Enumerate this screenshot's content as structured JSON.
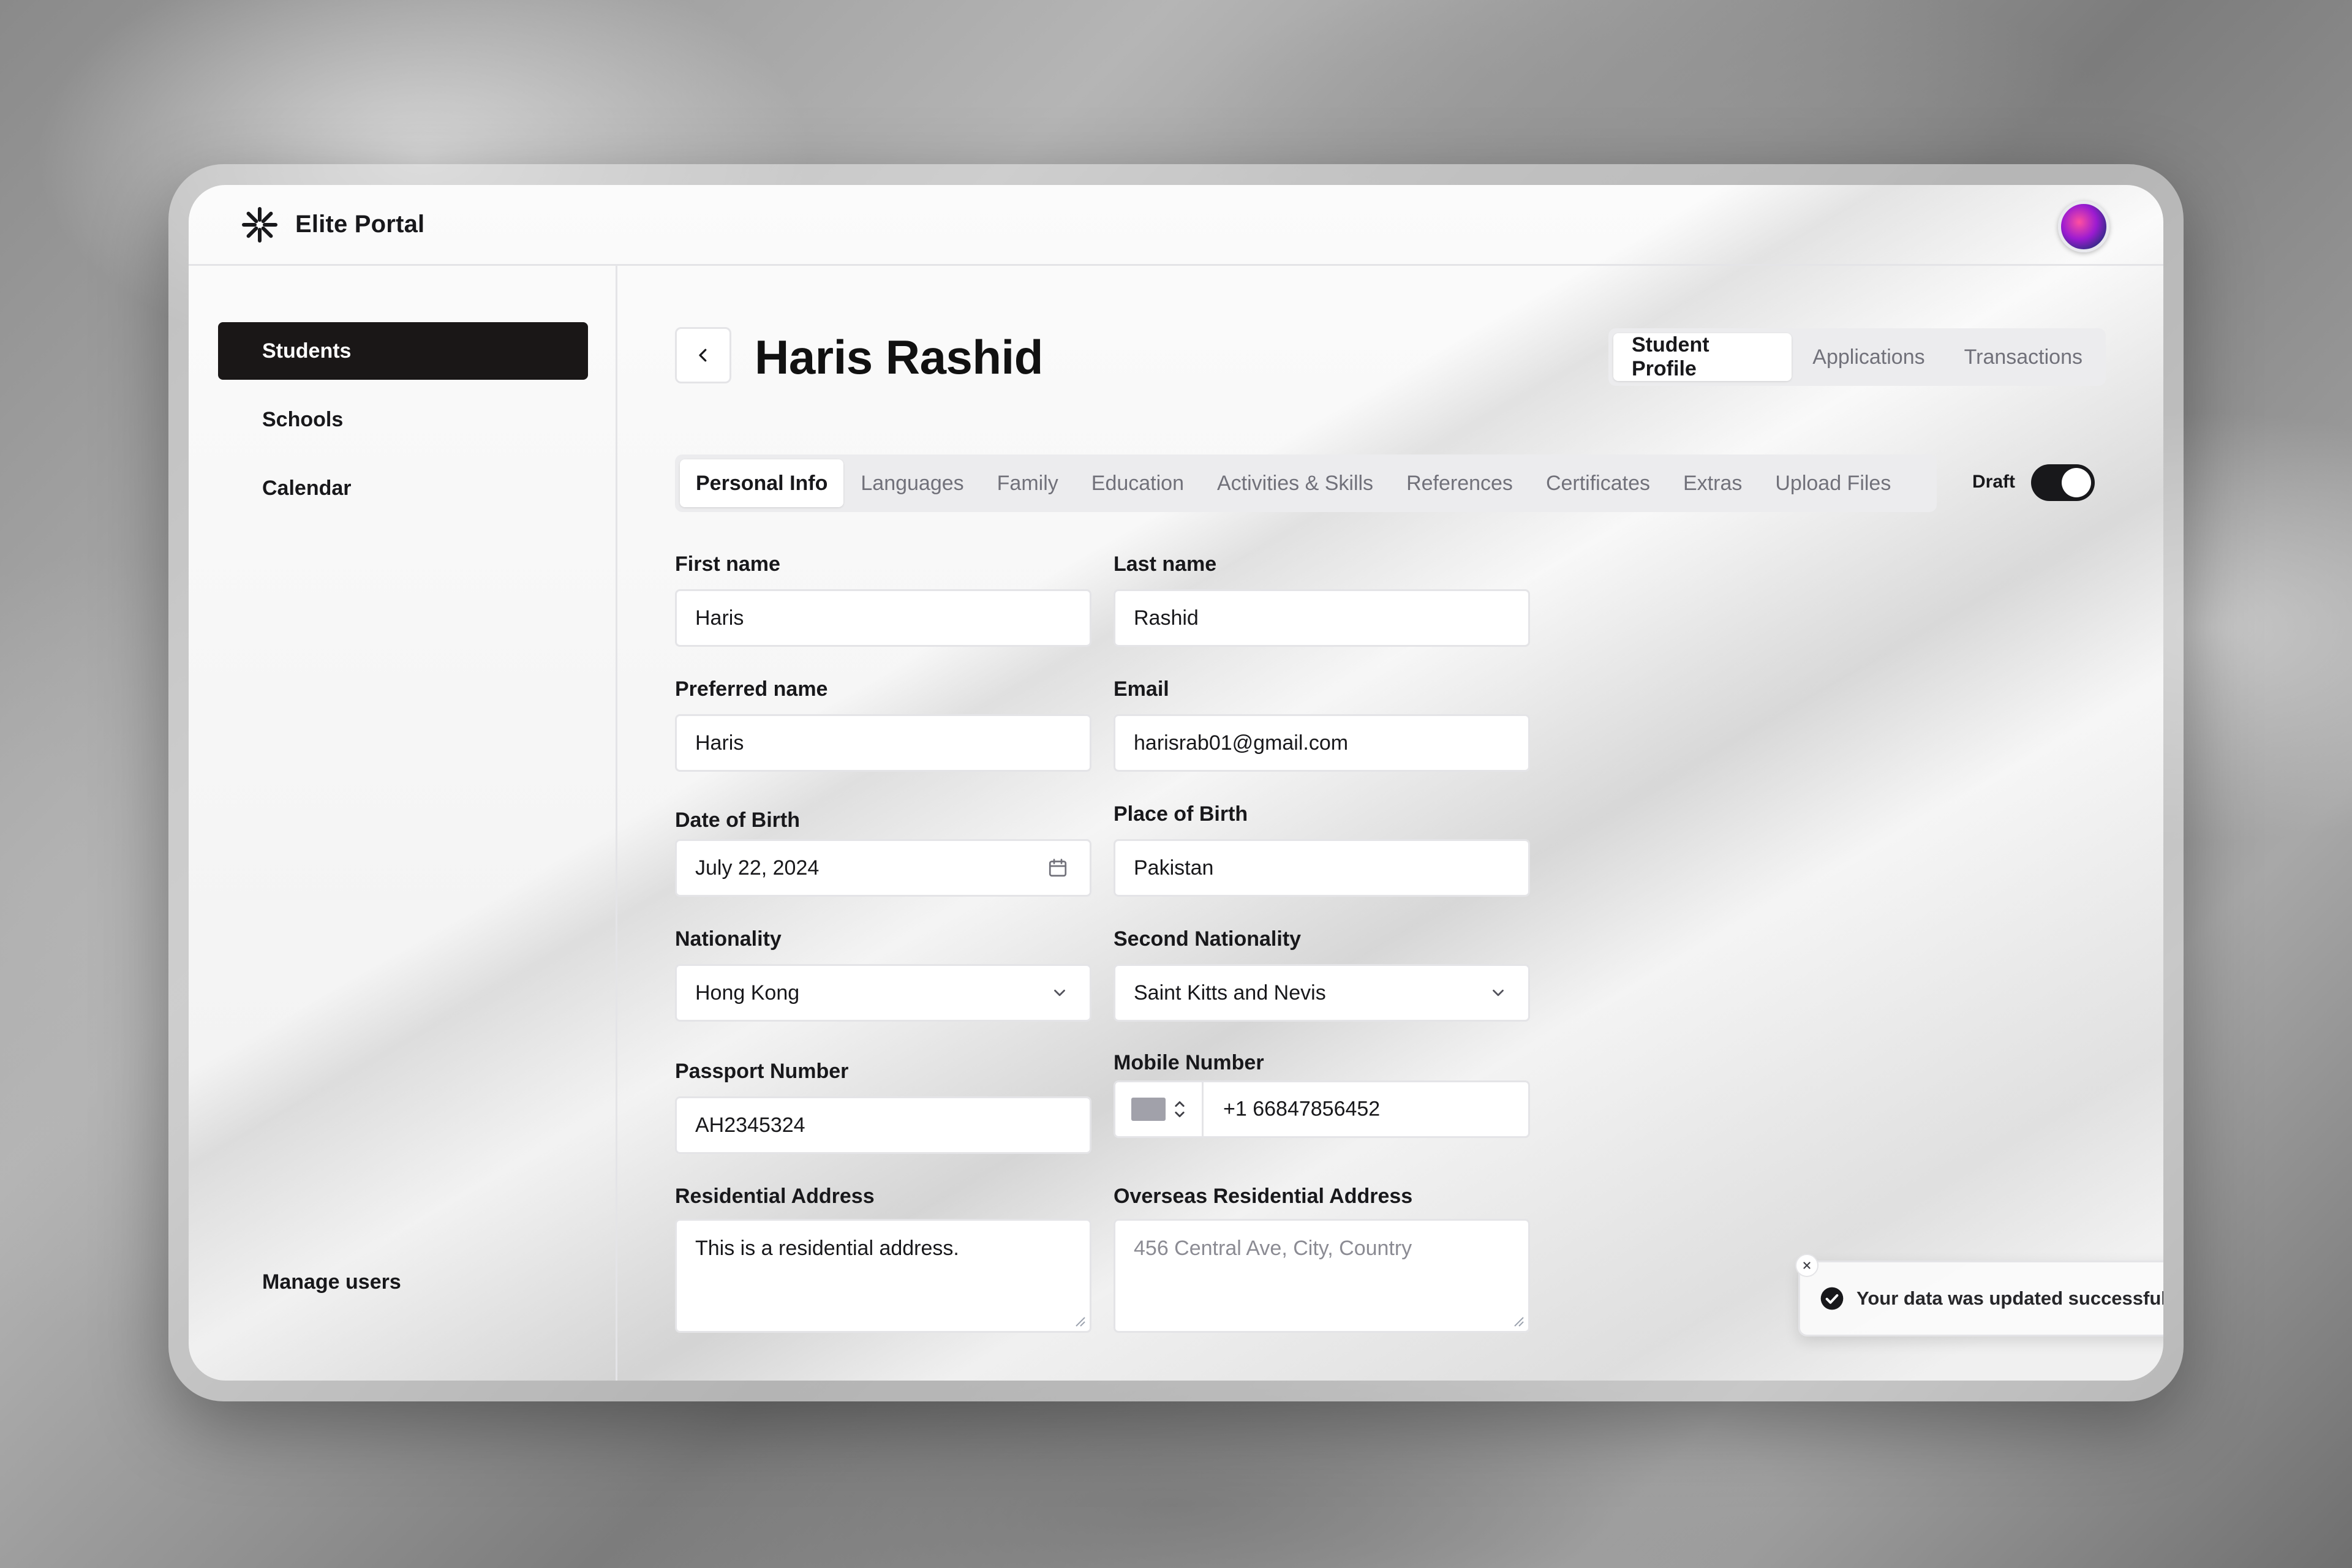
{
  "app": {
    "name": "Elite Portal",
    "brand_icon": "asterisk-logo-icon",
    "avatar_icon": "user-avatar"
  },
  "sidebar": {
    "items": [
      {
        "label": "Students",
        "active": true
      },
      {
        "label": "Schools",
        "active": false
      },
      {
        "label": "Calendar",
        "active": false
      }
    ],
    "footer_item": "Manage users"
  },
  "header": {
    "title": "Haris Rashid",
    "back_icon": "chevron-left-icon",
    "tabs": [
      {
        "label": "Student Profile",
        "active": true
      },
      {
        "label": "Applications",
        "active": false
      },
      {
        "label": "Transactions",
        "active": false
      }
    ]
  },
  "sections": {
    "tabs": [
      {
        "label": "Personal Info",
        "active": true
      },
      {
        "label": "Languages",
        "active": false
      },
      {
        "label": "Family",
        "active": false
      },
      {
        "label": "Education",
        "active": false
      },
      {
        "label": "Activities & Skills",
        "active": false
      },
      {
        "label": "References",
        "active": false
      },
      {
        "label": "Certificates",
        "active": false
      },
      {
        "label": "Extras",
        "active": false
      },
      {
        "label": "Upload Files",
        "active": false
      }
    ],
    "draft_label": "Draft",
    "draft_enabled": true
  },
  "form": {
    "first_name": {
      "label": "First name",
      "value": "Haris"
    },
    "last_name": {
      "label": "Last name",
      "value": "Rashid"
    },
    "preferred_name": {
      "label": "Preferred name",
      "value": "Haris"
    },
    "email": {
      "label": "Email",
      "value": "harisrab01@gmail.com"
    },
    "date_of_birth": {
      "label": "Date of Birth",
      "value": "July 22, 2024",
      "icon": "calendar-icon"
    },
    "place_of_birth": {
      "label": "Place of Birth",
      "value": "Pakistan"
    },
    "nationality": {
      "label": "Nationality",
      "value": "Hong Kong",
      "icon": "chevron-down-icon"
    },
    "second_nationality": {
      "label": "Second Nationality",
      "value": "Saint Kitts and Nevis",
      "icon": "chevron-down-icon"
    },
    "passport_number": {
      "label": "Passport Number",
      "value": "AH2345324"
    },
    "mobile_number": {
      "label": "Mobile Number",
      "value": "+1 66847856452"
    },
    "residential_address": {
      "label": "Residential Address",
      "value": "This is a residential address."
    },
    "overseas_address": {
      "label": "Overseas Residential Address",
      "placeholder": "456 Central Ave, City, Country"
    }
  },
  "toast": {
    "message": "Your data was updated successfully.",
    "icon": "check-circle-icon",
    "close_icon": "close-icon"
  },
  "colors": {
    "active_nav_bg": "#1a1717",
    "border": "#e4e4e7",
    "muted_text": "#71717a",
    "toggle_on": "#18181b"
  }
}
